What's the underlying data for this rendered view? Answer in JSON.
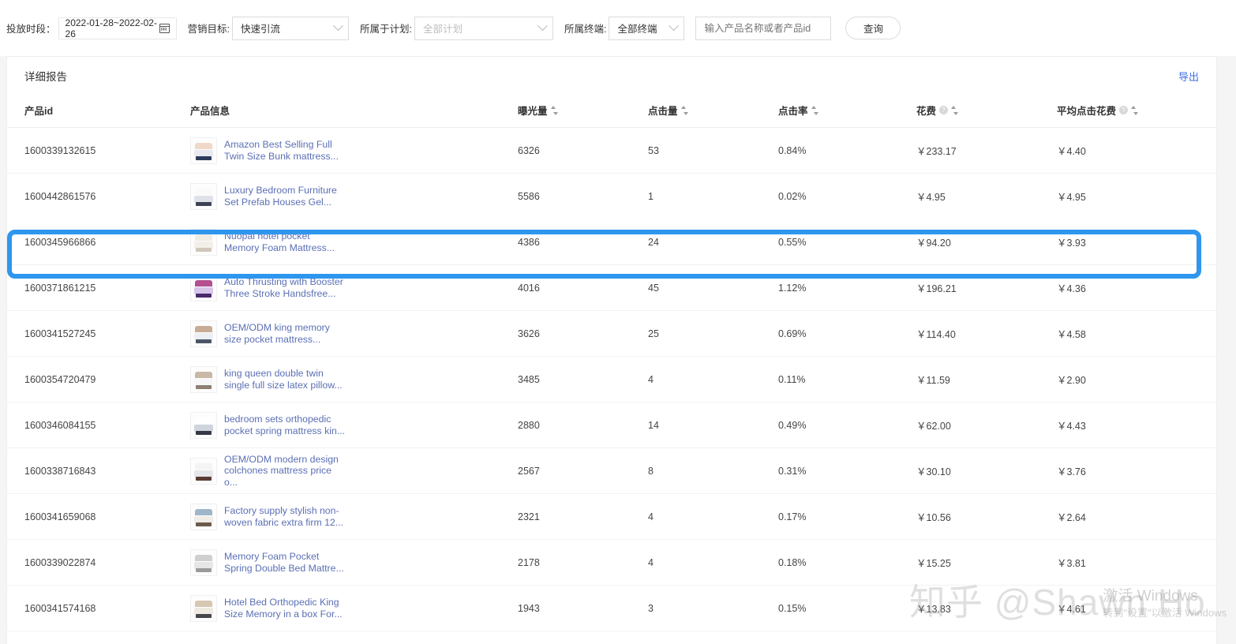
{
  "toolbar": {
    "date_label": "投放时段：",
    "date_value": "2022-01-28~2022-02-26",
    "calendar_icon": "calendar-icon",
    "goal_label": "营销目标:",
    "goal_value": "快速引流",
    "plan_label": "所属于计划:",
    "plan_value": "全部计划",
    "terminal_label": "所属终端:",
    "terminal_value": "全部终端",
    "search_placeholder": "输入产品名称或者产品id",
    "search_value": "",
    "query_button": "查询"
  },
  "card": {
    "title": "详细报告",
    "export_label": "导出"
  },
  "table": {
    "columns": [
      {
        "key": "id",
        "label": "产品id",
        "sortable": false,
        "info": false
      },
      {
        "key": "info",
        "label": "产品信息",
        "sortable": false,
        "info": false
      },
      {
        "key": "imp",
        "label": "曝光量",
        "sortable": true,
        "info": false
      },
      {
        "key": "clk",
        "label": "点击量",
        "sortable": true,
        "info": false
      },
      {
        "key": "ctr",
        "label": "点击率",
        "sortable": true,
        "info": false
      },
      {
        "key": "cost",
        "label": "花费",
        "sortable": true,
        "info": true
      },
      {
        "key": "avg",
        "label": "平均点击花费",
        "sortable": true,
        "info": true
      }
    ],
    "rows": [
      {
        "id": "1600339132615",
        "title1": "Amazon Best Selling Full",
        "title2": "Twin Size Bunk mattress...",
        "imp": "6326",
        "clk": "53",
        "ctr": "0.84%",
        "cost": "￥233.17",
        "avg": "￥4.40",
        "highlighted": false,
        "thumb": {
          "mat": "#e8eaf0",
          "base": "#2c3a5c",
          "hdb": "#f0d9c8"
        }
      },
      {
        "id": "1600442861576",
        "title1": "Luxury Bedroom Furniture",
        "title2": "Set Prefab Houses Gel...",
        "imp": "5586",
        "clk": "1",
        "ctr": "0.02%",
        "cost": "￥4.95",
        "avg": "￥4.95",
        "highlighted": true,
        "thumb": {
          "mat": "#dfe3e9",
          "base": "#3c4454",
          "hdb": "#fafafa"
        }
      },
      {
        "id": "1600345966866",
        "title1": "Nuopai hotel pocket",
        "title2": "Memory Foam Mattress...",
        "imp": "4386",
        "clk": "24",
        "ctr": "0.55%",
        "cost": "￥94.20",
        "avg": "￥3.93",
        "highlighted": false,
        "thumb": {
          "mat": "#f2efe8",
          "base": "#cfc7bb",
          "hdb": "#efece4"
        }
      },
      {
        "id": "1600371861215",
        "title1": "Auto Thrusting with Booster",
        "title2": "Three Stroke Handsfree...",
        "imp": "4016",
        "clk": "45",
        "ctr": "1.12%",
        "cost": "￥196.21",
        "avg": "￥4.36",
        "highlighted": false,
        "thumb": {
          "mat": "#d8c6e8",
          "base": "#4b2a6b",
          "hdb": "#b4508f"
        }
      },
      {
        "id": "1600341527245",
        "title1": "OEM/ODM king memory",
        "title2": "size pocket mattress...",
        "imp": "3626",
        "clk": "25",
        "ctr": "0.69%",
        "cost": "￥114.40",
        "avg": "￥4.58",
        "highlighted": false,
        "thumb": {
          "mat": "#eceff4",
          "base": "#4a5668",
          "hdb": "#c7ad95"
        }
      },
      {
        "id": "1600354720479",
        "title1": "king queen double twin",
        "title2": "single full size latex pillow...",
        "imp": "3485",
        "clk": "4",
        "ctr": "0.11%",
        "cost": "￥11.59",
        "avg": "￥2.90",
        "highlighted": false,
        "thumb": {
          "mat": "#f7f7f7",
          "base": "#8e7f72",
          "hdb": "#c9b8a6"
        }
      },
      {
        "id": "1600346084155",
        "title1": "bedroom sets orthopedic",
        "title2": "pocket spring mattress kin...",
        "imp": "2880",
        "clk": "14",
        "ctr": "0.49%",
        "cost": "￥62.00",
        "avg": "￥4.43",
        "highlighted": false,
        "thumb": {
          "mat": "#cfd4dd",
          "base": "#333a45",
          "hdb": "#ffffff"
        }
      },
      {
        "id": "1600338716843",
        "title1": "OEM/ODM modern design",
        "title2": "colchones mattress price o...",
        "imp": "2567",
        "clk": "8",
        "ctr": "0.31%",
        "cost": "￥30.10",
        "avg": "￥3.76",
        "highlighted": false,
        "thumb": {
          "mat": "#e5e7ea",
          "base": "#5a3a33",
          "hdb": "#f4f4f4"
        }
      },
      {
        "id": "1600341659068",
        "title1": "Factory supply stylish non-",
        "title2": "woven fabric extra firm 12...",
        "imp": "2321",
        "clk": "4",
        "ctr": "0.17%",
        "cost": "￥10.56",
        "avg": "￥2.64",
        "highlighted": false,
        "thumb": {
          "mat": "#f0ece6",
          "base": "#6c5a4a",
          "hdb": "#9fb7c9"
        }
      },
      {
        "id": "1600339022874",
        "title1": "Memory Foam Pocket",
        "title2": "Spring Double Bed Mattre...",
        "imp": "2178",
        "clk": "4",
        "ctr": "0.18%",
        "cost": "￥15.25",
        "avg": "￥3.81",
        "highlighted": false,
        "thumb": {
          "mat": "#e6e6e6",
          "base": "#9b9b9b",
          "hdb": "#cfcfcf"
        }
      },
      {
        "id": "1600341574168",
        "title1": "Hotel Bed Orthopedic King",
        "title2": "Size Memory in a box For...",
        "imp": "1943",
        "clk": "3",
        "ctr": "0.15%",
        "cost": "￥13.83",
        "avg": "￥4.61",
        "highlighted": false,
        "thumb": {
          "mat": "#eeeae2",
          "base": "#44474c",
          "hdb": "#d6c6b2"
        }
      }
    ]
  },
  "watermarks": {
    "zhihu": "知乎 @Shawn Ho",
    "windows_line1": "激活 Windows",
    "windows_line2": "转到\"设置\"以激活 Windows"
  },
  "colors": {
    "accent_blue": "#2e96ef",
    "link_blue": "#3d6ee6",
    "product_link": "#5b6fb5"
  }
}
